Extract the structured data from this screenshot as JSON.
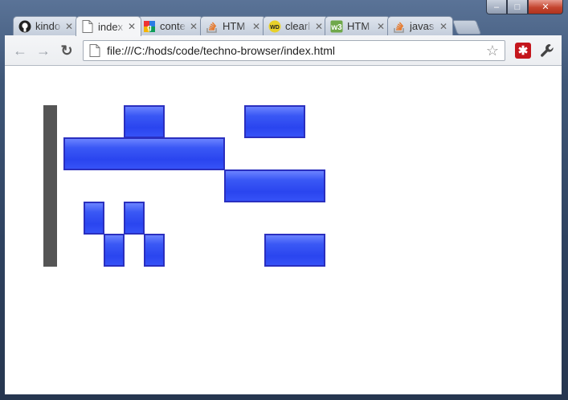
{
  "window": {
    "controls": {
      "minimize": "–",
      "maximize": "□",
      "close": "✕"
    }
  },
  "tabs": [
    {
      "label": "kindo",
      "icon": "github-icon",
      "active": false
    },
    {
      "label": "index",
      "icon": "page-icon",
      "active": true
    },
    {
      "label": "conte",
      "icon": "google-icon",
      "active": false
    },
    {
      "label": "HTM",
      "icon": "stackoverflow-icon",
      "active": false
    },
    {
      "label": "clearl",
      "icon": "webdev-icon",
      "active": false
    },
    {
      "label": "HTM",
      "icon": "w3-icon",
      "active": false
    },
    {
      "label": "javas",
      "icon": "stackoverflow-icon",
      "active": false
    }
  ],
  "toolbar": {
    "back": "←",
    "forward": "→",
    "reload": "↻",
    "url": "file:///C:/hods/code/techno-browser/index.html",
    "star": "☆",
    "extension": "✱",
    "wrench": "🔧"
  },
  "grid": {
    "rows": 5,
    "cols": 16,
    "cell_color": "#ececec",
    "block_color": "#2a45ef",
    "blocks": [
      {
        "row": 0,
        "col": 4,
        "span": 2,
        "rowspan": 1
      },
      {
        "row": 0,
        "col": 10,
        "span": 3,
        "rowspan": 1
      },
      {
        "row": 1,
        "col": 1,
        "span": 8,
        "rowspan": 1
      },
      {
        "row": 2,
        "col": 9,
        "span": 5,
        "rowspan": 1
      },
      {
        "row": 3,
        "col": 2,
        "span": 1,
        "rowspan": 1
      },
      {
        "row": 3,
        "col": 4,
        "span": 1,
        "rowspan": 1
      },
      {
        "row": 4,
        "col": 3,
        "span": 1,
        "rowspan": 1
      },
      {
        "row": 4,
        "col": 5,
        "span": 1,
        "rowspan": 1
      },
      {
        "row": 4,
        "col": 11,
        "span": 3,
        "rowspan": 1
      }
    ]
  }
}
